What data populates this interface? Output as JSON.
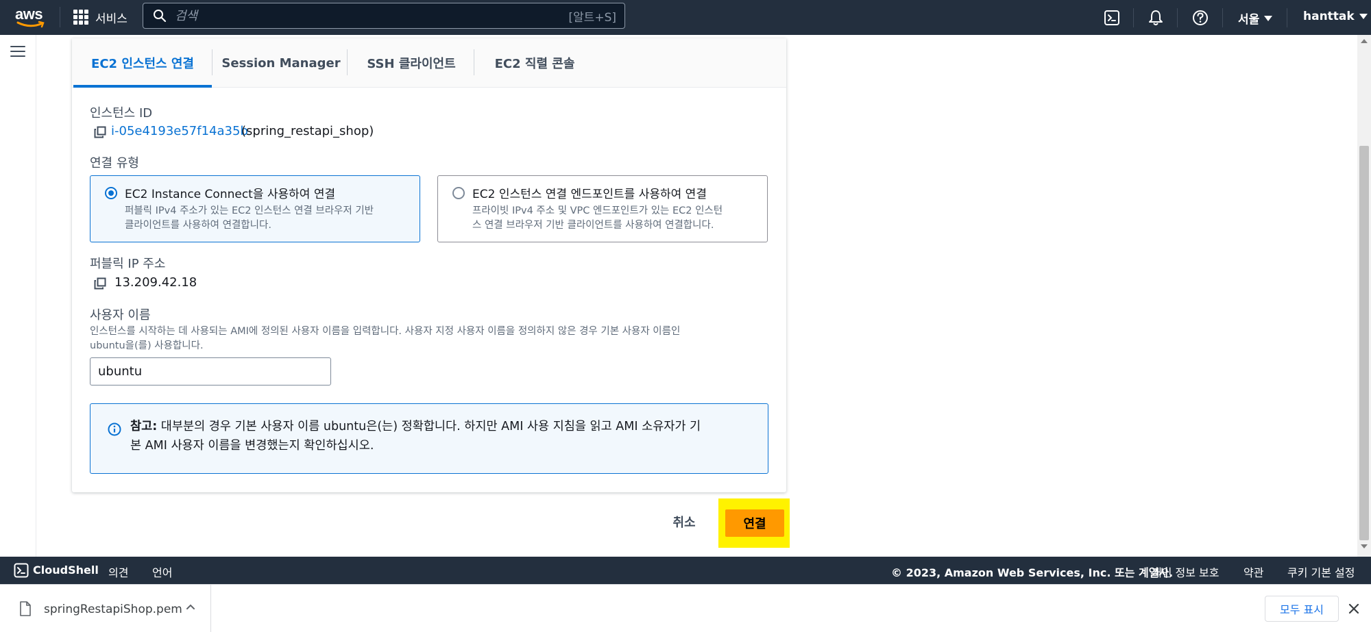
{
  "topnav": {
    "logo_text": "aws",
    "services_label": "서비스",
    "search_placeholder": "검색",
    "search_shortcut": "[알트+S]",
    "region": "서울",
    "user": "hanttak"
  },
  "tabs": [
    {
      "label": "EC2 인스턴스 연결"
    },
    {
      "label": "Session Manager"
    },
    {
      "label": "SSH 클라이언트"
    },
    {
      "label": "EC2 직렬 콘솔"
    }
  ],
  "instance": {
    "label": "인스턴스 ID",
    "id": "i-05e4193e57f14a35b",
    "name": "(spring_restapi_shop)"
  },
  "connection_type": {
    "label": "연결 유형",
    "options": [
      {
        "title": "EC2 Instance Connect을 사용하여 연결",
        "desc_line1": "퍼블릭 IPv4 주소가 있는 EC2 인스턴스 연결 브라우저 기반",
        "desc_line2": "클라이언트를 사용하여 연결합니다."
      },
      {
        "title": "EC2 인스턴스 연결 엔드포인트를 사용하여 연결",
        "desc_line1": "프라이빗 IPv4 주소 및 VPC 엔드포인트가 있는 EC2 인스턴",
        "desc_line2": "스 연결 브라우저 기반 클라이언트를 사용하여 연결합니다."
      }
    ]
  },
  "public_ip": {
    "label": "퍼블릭 IP 주소",
    "value": "13.209.42.18"
  },
  "username": {
    "label": "사용자 이름",
    "help_line1": "인스턴스를 시작하는 데 사용되는 AMI에 정의된 사용자 이름을 입력합니다. 사용자 지정 사용자 이름을 정의하지 않은 경우 기본 사용자 이름인",
    "help_line2": "ubuntu을(를) 사용합니다.",
    "value": "ubuntu"
  },
  "info": {
    "bold": "참고:",
    "line1": " 대부분의 경우 기본 사용자 이름 ubuntu은(는) 정확합니다. 하지만 AMI 사용 지침을 읽고 AMI 소유자가 기",
    "line2": "본 AMI 사용자 이름을 변경했는지 확인하십시오."
  },
  "actions": {
    "cancel": "취소",
    "connect": "연결"
  },
  "footer": {
    "cloudshell": "CloudShell",
    "feedback": "의견",
    "language": "언어",
    "copyright": "© 2023, Amazon Web Services, Inc. 또는 계열사.",
    "privacy": "개인 정보 보호",
    "terms": "약관",
    "cookies": "쿠키 기본 설정"
  },
  "download": {
    "file": "springRestapiShop.pem",
    "show_all": "모두 표시"
  },
  "colors": {
    "nav_bg": "#232f3e",
    "accent_blue": "#0972d3",
    "primary_orange": "#ff9900",
    "highlight_yellow": "#fff200"
  }
}
